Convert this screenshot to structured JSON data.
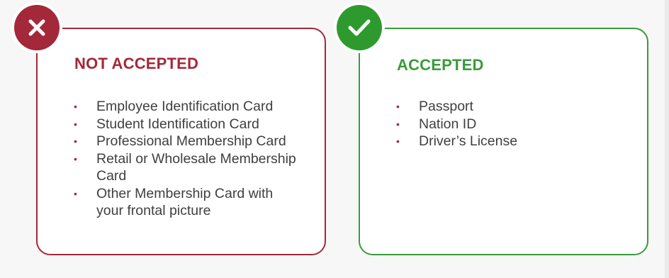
{
  "not_accepted": {
    "icon": "close-icon",
    "color": "#a3283a",
    "heading": "NOT ACCEPTED",
    "items": [
      "Employee Identification Card",
      "Student Identification Card",
      "Professional Membership Card",
      "Retail or Wholesale Membership Card",
      "Other Membership Card with your frontal picture"
    ]
  },
  "accepted": {
    "icon": "check-icon",
    "color": "#3a9b3a",
    "heading": "ACCEPTED",
    "items": [
      "Passport",
      "Nation ID",
      "Driver’s License"
    ]
  }
}
